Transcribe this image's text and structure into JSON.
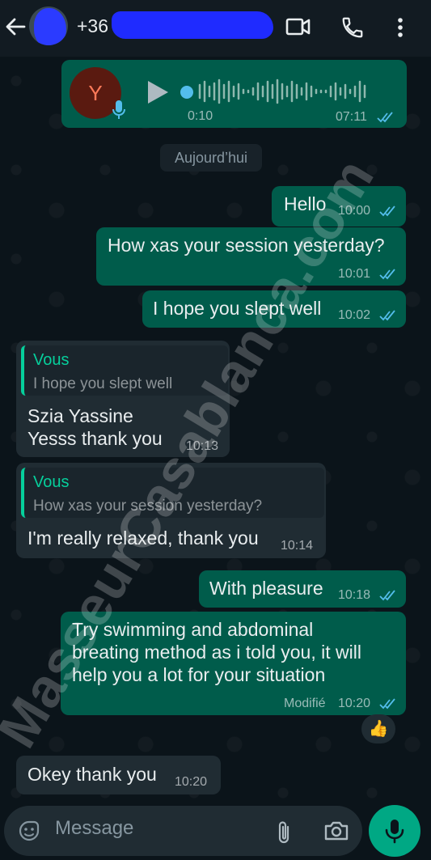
{
  "header": {
    "contact_phone": "+36",
    "icons": [
      "back-arrow-icon",
      "video-call-icon",
      "voice-call-icon",
      "more-options-icon"
    ]
  },
  "voice_note": {
    "avatar_letter": "Y",
    "duration": "0:10",
    "time": "07:11"
  },
  "date_separator": "Aujourd’hui",
  "messages": [
    {
      "direction": "out",
      "text": "Hello",
      "time": "10:00"
    },
    {
      "direction": "out",
      "text": "How xas your session yesterday?",
      "time": "10:01"
    },
    {
      "direction": "out",
      "text": "I hope you slept well",
      "time": "10:02"
    },
    {
      "direction": "in",
      "quote_author": "Vous",
      "quote_text": "I hope you slept well",
      "lines": [
        "Szia Yassine",
        "Yesss thank you"
      ],
      "time": "10:13"
    },
    {
      "direction": "in",
      "quote_author": "Vous",
      "quote_text": "How xas your session yesterday?",
      "text": "I'm really relaxed, thank you",
      "time": "10:14"
    },
    {
      "direction": "out",
      "text": "With pleasure",
      "time": "10:18"
    },
    {
      "direction": "out",
      "lines": [
        "Try swimming and abdominal",
        "breating method as i told you, it will",
        "help you a lot for your situation"
      ],
      "edited_label": "Modifié",
      "time": "10:20",
      "reaction": "👍"
    },
    {
      "direction": "in",
      "text": "Okey thank you",
      "time": "10:20"
    }
  ],
  "composer": {
    "placeholder": "Message"
  },
  "watermark": "MasseurCasablanca.com",
  "colors": {
    "outgoing_bubble": "#005c4b",
    "incoming_bubble": "#202c33",
    "accent": "#00a884",
    "read_ticks": "#53bdeb",
    "quote_author": "#06cf9c"
  }
}
